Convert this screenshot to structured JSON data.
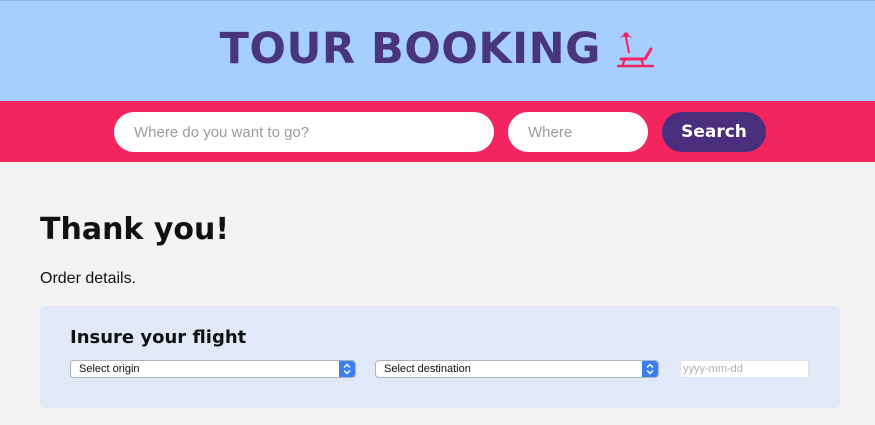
{
  "header": {
    "title": "TOUR BOOKING",
    "icon": "beach-chair-icon",
    "background": "#a6cffd",
    "title_color": "#48357c"
  },
  "search": {
    "destination_placeholder": "Where do you want to go?",
    "where_placeholder": "Where",
    "button_label": "Search",
    "bar_color": "#f2255e",
    "button_color": "#4b2f7f"
  },
  "main": {
    "heading": "Thank you!",
    "subtext": "Order details."
  },
  "insurance": {
    "title": "Insure your flight",
    "origin_select": "Select origin",
    "destination_select": "Select destination",
    "date_placeholder": "yyyy-mm-dd",
    "panel_color": "#e1e9f8"
  }
}
